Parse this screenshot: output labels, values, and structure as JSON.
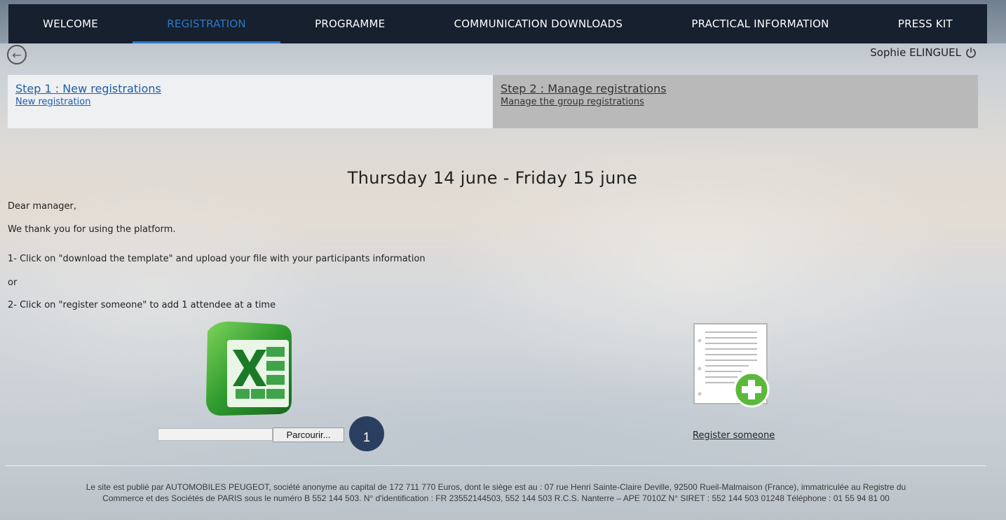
{
  "nav": {
    "items": [
      {
        "label": "WELCOME",
        "active": false
      },
      {
        "label": "REGISTRATION",
        "active": true
      },
      {
        "label": "PROGRAMME",
        "active": false
      },
      {
        "label": "COMMUNICATION DOWNLOADS",
        "active": false
      },
      {
        "label": "PRACTICAL INFORMATION",
        "active": false
      },
      {
        "label": "PRESS KIT",
        "active": false
      }
    ],
    "background": "#16202e",
    "active_color": "#2e78c8"
  },
  "user": {
    "name": "Sophie ELINGUEL",
    "logout_icon": "power-icon"
  },
  "back_icon": "arrow-left-circle-icon",
  "steps": [
    {
      "title": "Step 1 : New registrations",
      "subtitle": "New registration"
    },
    {
      "title": "Step 2 : Manage registrations",
      "subtitle": "Manage the group registrations"
    }
  ],
  "content": {
    "date_range": "Thursday 14 june - Friday 15 june",
    "greeting": "Dear manager,",
    "thanks": "We thank you for using the platform.",
    "instruction_1": "1- Click on \"download the template\" and upload your file with your participants information",
    "or": "or",
    "instruction_2": "2- Click on \"register someone\" to add 1 attendee at a time"
  },
  "upload": {
    "icon": "excel-icon",
    "file_value": "",
    "browse_label": "Parcourir...",
    "badge": "1"
  },
  "register": {
    "icon": "document-add-icon",
    "label": "Register someone"
  },
  "footer": {
    "line1": "Le site est publié par AUTOMOBILES PEUGEOT, société anonyme au capital de 172 711 770 Euros, dont le siège est au : 07 rue Henri Sainte-Claire Deville, 92500 Rueil-Malmaison (France), immatriculée au Registre du",
    "line2": "Commerce et des Sociétés de PARIS sous le numéro B 552 144 503. N° d'identification : FR 23552144503, 552 144 503 R.C.S. Nanterre – APE 7010Z N° SIRET : 552 144 503 01248 Téléphone : 01 55 94 81 00"
  }
}
